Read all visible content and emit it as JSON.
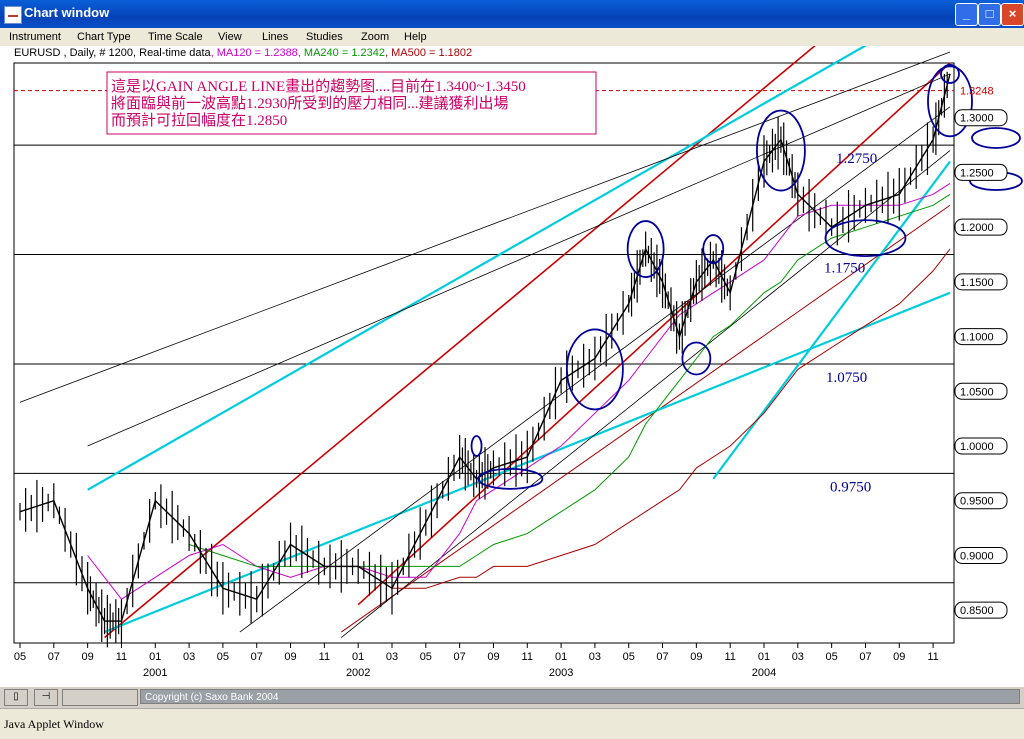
{
  "window": {
    "title": "Chart window",
    "minimize": "_",
    "maximize": "□",
    "close": "×"
  },
  "menu": [
    "Instrument",
    "Chart Type",
    "Time Scale",
    "View",
    "Lines",
    "Studies",
    "Zoom",
    "Help"
  ],
  "legend": {
    "symbol": "EURUSD , Daily, # 1200, Real-time data",
    "ma120": ", MA120 = 1.2388",
    "ma240": ", MA240 = 1.2342",
    "ma500": ", MA500 = 1.1802"
  },
  "annotation": {
    "line1": "這是以GAIN ANGLE LINE畫出的趨勢图....目前在1.3400~1.3450",
    "line2": "將面臨與前一波高點1.2930所受到的壓力相同...建議獲利出場",
    "line3": "而預計可拉回幅度在1.2850"
  },
  "status": {
    "copyright": "Copyright (c) Saxo Bank 2004",
    "applet": "Java Applet Window"
  },
  "colors": {
    "price": "#000000",
    "ma120": "#cc00cc",
    "ma240": "#009900",
    "ma500": "#aa0000",
    "gain_angle": "#cc0000",
    "channel": "#00ccdd",
    "annotation": "#cc0066",
    "circle": "#000099"
  },
  "chart_data": {
    "type": "line",
    "title": "EURUSD , Daily, # 1200, Real-time data",
    "x": [
      "2000-05",
      "2000-07",
      "2000-09",
      "2000-10",
      "2000-11",
      "2001-01",
      "2001-03",
      "2001-05",
      "2001-07",
      "2001-09",
      "2001-11",
      "2002-01",
      "2002-03",
      "2002-05",
      "2002-07",
      "2002-08",
      "2002-09",
      "2002-11",
      "2003-01",
      "2003-03",
      "2003-05",
      "2003-06",
      "2003-07",
      "2003-08",
      "2003-09",
      "2003-10",
      "2003-11",
      "2004-01",
      "2004-02",
      "2004-03",
      "2004-05",
      "2004-07",
      "2004-09",
      "2004-11",
      "2004-12"
    ],
    "series": [
      {
        "name": "EURUSD",
        "values": [
          0.94,
          0.95,
          0.87,
          0.84,
          0.84,
          0.95,
          0.92,
          0.87,
          0.86,
          0.91,
          0.89,
          0.89,
          0.87,
          0.93,
          0.99,
          0.97,
          0.98,
          0.99,
          1.06,
          1.08,
          1.13,
          1.18,
          1.15,
          1.1,
          1.15,
          1.17,
          1.14,
          1.26,
          1.28,
          1.23,
          1.2,
          1.22,
          1.23,
          1.28,
          1.34
        ]
      },
      {
        "name": "MA120",
        "values": [
          null,
          null,
          0.9,
          0.88,
          0.86,
          0.88,
          0.9,
          0.91,
          0.89,
          0.88,
          0.89,
          0.89,
          0.88,
          0.88,
          0.92,
          0.95,
          0.96,
          0.98,
          1.0,
          1.03,
          1.06,
          1.08,
          1.1,
          1.12,
          1.13,
          1.14,
          1.15,
          1.17,
          1.19,
          1.21,
          1.22,
          1.22,
          1.22,
          1.23,
          1.24
        ]
      },
      {
        "name": "MA240",
        "values": [
          null,
          null,
          null,
          null,
          null,
          null,
          0.91,
          0.9,
          0.89,
          0.89,
          0.89,
          0.89,
          0.89,
          0.89,
          0.89,
          0.9,
          0.91,
          0.92,
          0.94,
          0.96,
          0.99,
          1.02,
          1.04,
          1.06,
          1.08,
          1.1,
          1.11,
          1.14,
          1.15,
          1.17,
          1.19,
          1.2,
          1.21,
          1.22,
          1.23
        ]
      },
      {
        "name": "MA500",
        "values": [
          null,
          null,
          null,
          null,
          null,
          null,
          null,
          null,
          null,
          null,
          null,
          null,
          0.87,
          0.87,
          0.88,
          0.88,
          0.89,
          0.89,
          0.9,
          0.91,
          0.93,
          0.94,
          0.95,
          0.96,
          0.98,
          0.99,
          1.0,
          1.03,
          1.05,
          1.07,
          1.09,
          1.11,
          1.13,
          1.16,
          1.18
        ]
      }
    ],
    "ylim": [
      0.82,
      1.35
    ],
    "y_ticks": [
      "1.3248",
      "1.3000",
      "1.2500",
      "1.2000",
      "1.1500",
      "1.1000",
      "1.0500",
      "1.0000",
      "0.9500",
      "0.9000",
      "0.8500"
    ],
    "x_ticks": [
      "05",
      "07",
      "09",
      "11",
      "01",
      "03",
      "05",
      "07",
      "09",
      "11",
      "01",
      "03",
      "05",
      "07",
      "09",
      "11",
      "01",
      "03",
      "05",
      "07",
      "09",
      "11",
      "01",
      "03",
      "05",
      "07",
      "09",
      "11"
    ],
    "year_labels": [
      "2001",
      "2002",
      "2003",
      "2004"
    ],
    "horizontal_levels": [
      1.275,
      1.175,
      1.075,
      0.975,
      0.875
    ],
    "level_labels": [
      "1.2750",
      "1.1750",
      "1.0750",
      "0.9750"
    ],
    "last_price": 1.3248
  }
}
